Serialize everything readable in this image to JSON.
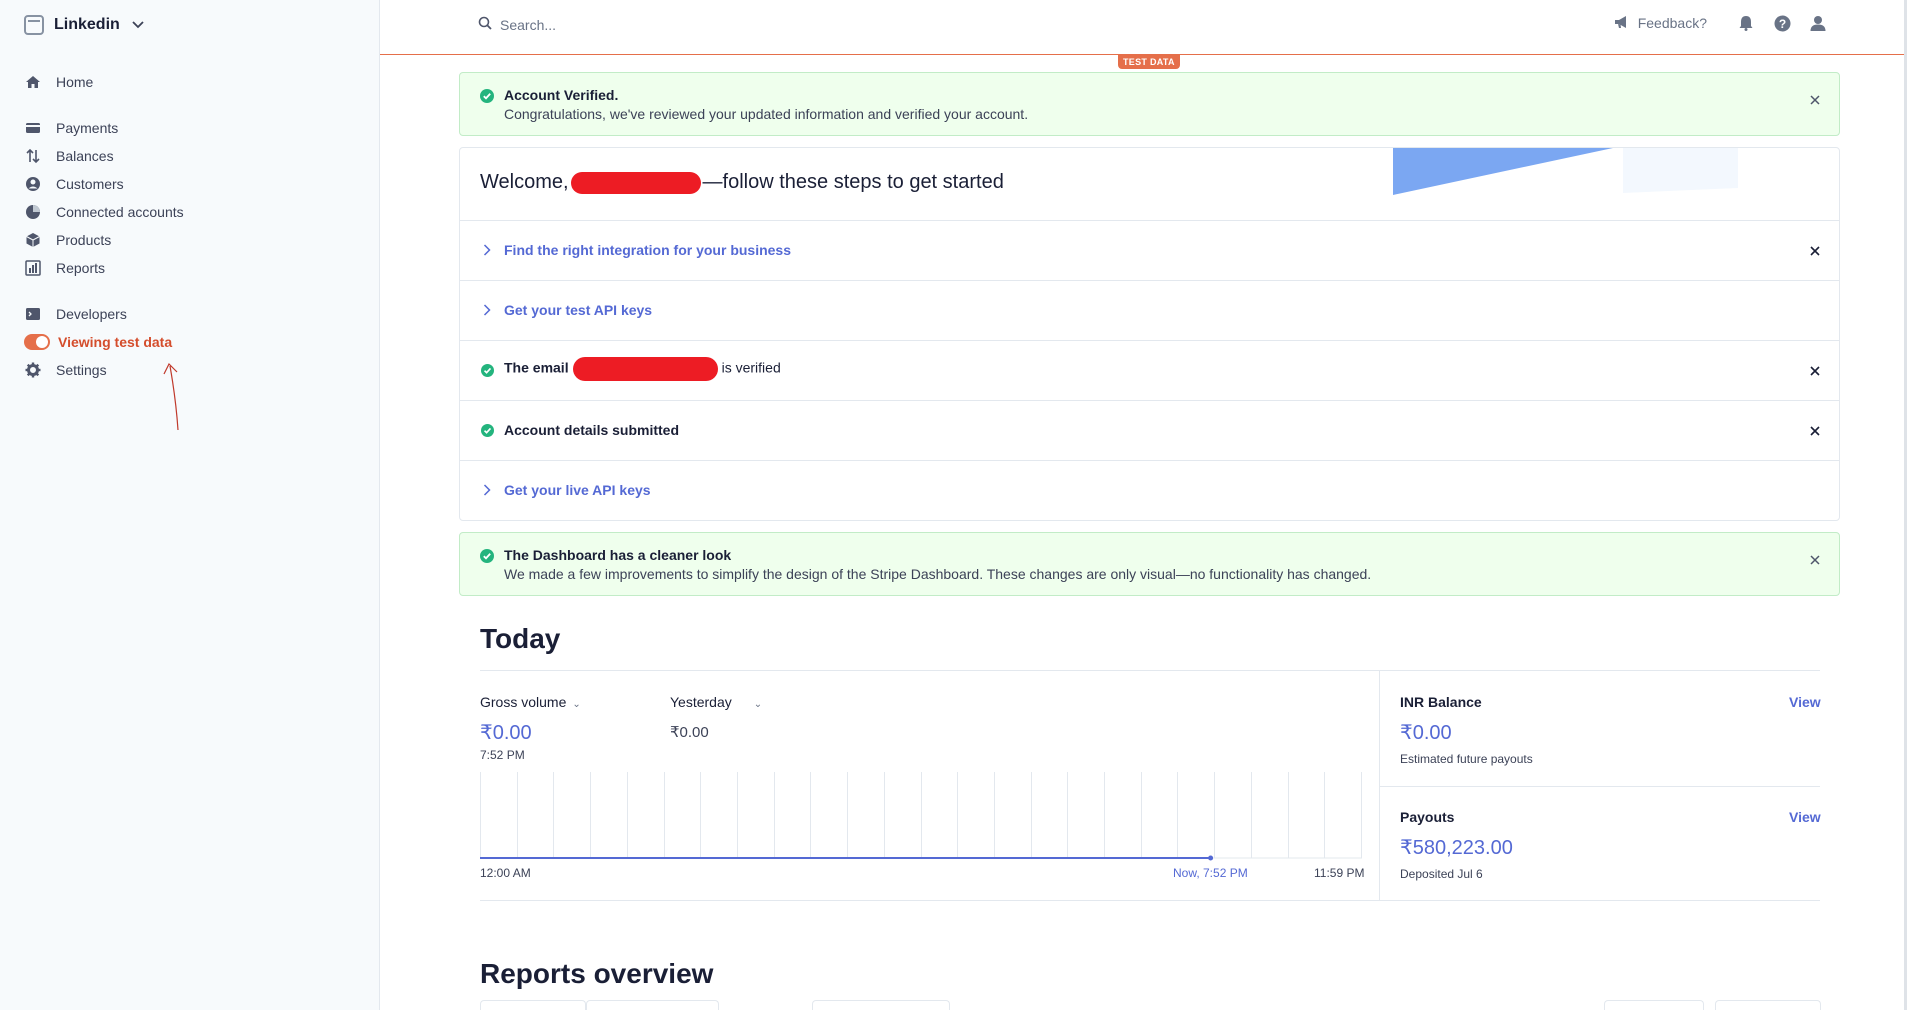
{
  "sidebar": {
    "account_name": "Linkedin",
    "items": [
      {
        "label": "Home",
        "icon": "home-icon"
      },
      {
        "label": "Payments",
        "icon": "payments-icon"
      },
      {
        "label": "Balances",
        "icon": "balances-icon"
      },
      {
        "label": "Customers",
        "icon": "customers-icon"
      },
      {
        "label": "Connected accounts",
        "icon": "connected-accounts-icon"
      },
      {
        "label": "Products",
        "icon": "products-icon"
      },
      {
        "label": "Reports",
        "icon": "reports-icon"
      },
      {
        "label": "Developers",
        "icon": "developers-icon"
      },
      {
        "label": "Viewing test data",
        "icon": "toggle-icon"
      },
      {
        "label": "Settings",
        "icon": "gear-icon"
      }
    ]
  },
  "topbar": {
    "search_placeholder": "Search...",
    "feedback_label": "Feedback?",
    "test_badge": "TEST DATA"
  },
  "banner_verified": {
    "title": "Account Verified.",
    "text": "Congratulations, we've reviewed your updated information and verified your account."
  },
  "steps": {
    "welcome_prefix": "Welcome,",
    "welcome_suffix": "—follow these steps to get started",
    "rows": [
      {
        "label": "Find the right integration for your business",
        "state": "todo",
        "closable": true
      },
      {
        "label": "Get your test API keys",
        "state": "todo",
        "closable": false
      },
      {
        "label_prefix": "The email",
        "label_suffix": "is verified",
        "state": "done",
        "closable": true
      },
      {
        "label": "Account details submitted",
        "state": "done",
        "closable": true
      },
      {
        "label": "Get your live API keys",
        "state": "todo",
        "closable": false
      }
    ]
  },
  "banner_cleaner": {
    "title": "The Dashboard has a cleaner look",
    "text": "We made a few improvements to simplify the design of the Stripe Dashboard. These changes are only visual—no functionality has changed."
  },
  "today": {
    "title": "Today",
    "gross_label": "Gross volume",
    "gross_value": "₹0.00",
    "gross_time": "7:52 PM",
    "compare_label": "Yesterday",
    "compare_value": "₹0.00",
    "axis_start": "12:00 AM",
    "axis_now": "Now, 7:52 PM",
    "axis_end": "11:59 PM",
    "balance_label": "INR Balance",
    "balance_value": "₹0.00",
    "balance_sub": "Estimated future payouts",
    "payouts_label": "Payouts",
    "payouts_value": "₹580,223.00",
    "payouts_sub": "Deposited Jul 6",
    "view_label": "View"
  },
  "reports": {
    "title": "Reports overview"
  },
  "chart_data": {
    "type": "line",
    "x": [
      "12:00 AM",
      "Now, 7:52 PM"
    ],
    "series": [
      {
        "values": [
          0,
          0
        ]
      }
    ],
    "xlabel": "",
    "ylabel": "",
    "grid": true
  },
  "colors": {
    "accent": "#5469d4",
    "test_orange": "#e56f4a",
    "success": "#3ecf8e"
  }
}
